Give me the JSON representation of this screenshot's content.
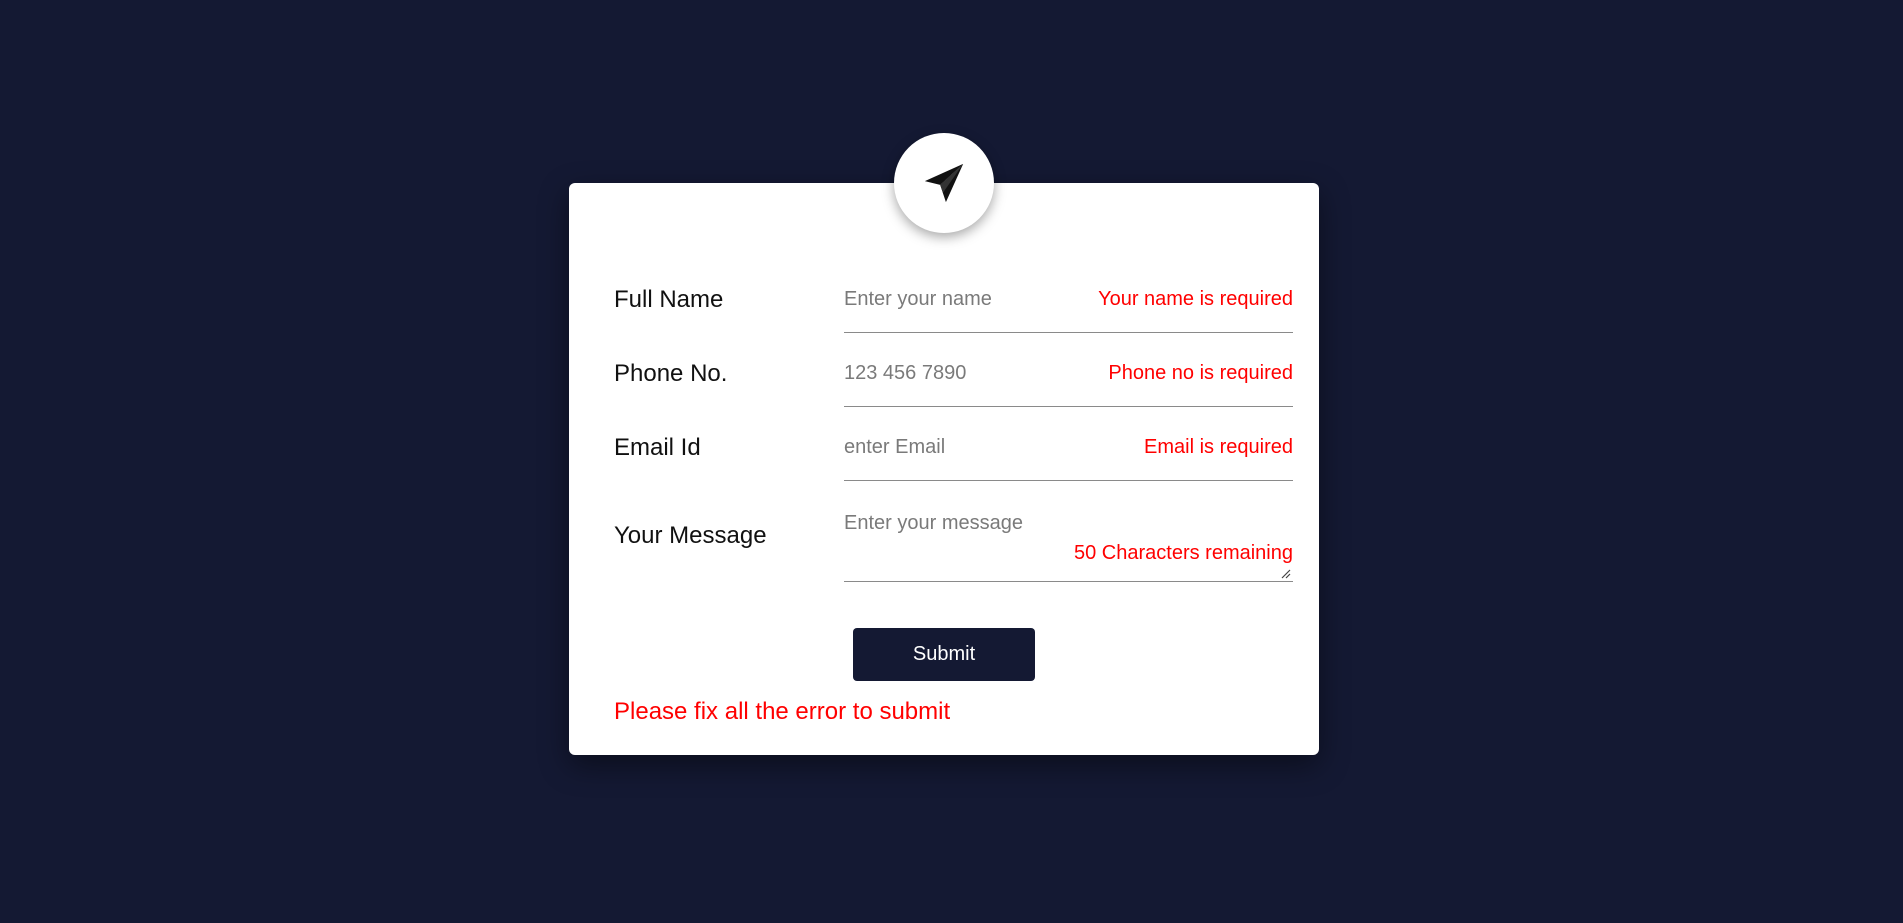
{
  "form": {
    "icon": "paper-plane-icon",
    "fields": [
      {
        "label": "Full Name",
        "placeholder": "Enter your name",
        "value": "",
        "error": "Your name is required"
      },
      {
        "label": "Phone No.",
        "placeholder": "123 456 7890",
        "value": "",
        "error": "Phone no is required"
      },
      {
        "label": "Email Id",
        "placeholder": "enter Email",
        "value": "",
        "error": "Email is required"
      }
    ],
    "message": {
      "label": "Your Message",
      "placeholder": "Enter your message",
      "value": "",
      "counter": "50 Characters remaining"
    },
    "submit_label": "Submit",
    "form_error": "Please fix all the error to submit"
  },
  "colors": {
    "background": "#141933",
    "card": "#ffffff",
    "error": "#ff0000",
    "button": "#141933"
  }
}
